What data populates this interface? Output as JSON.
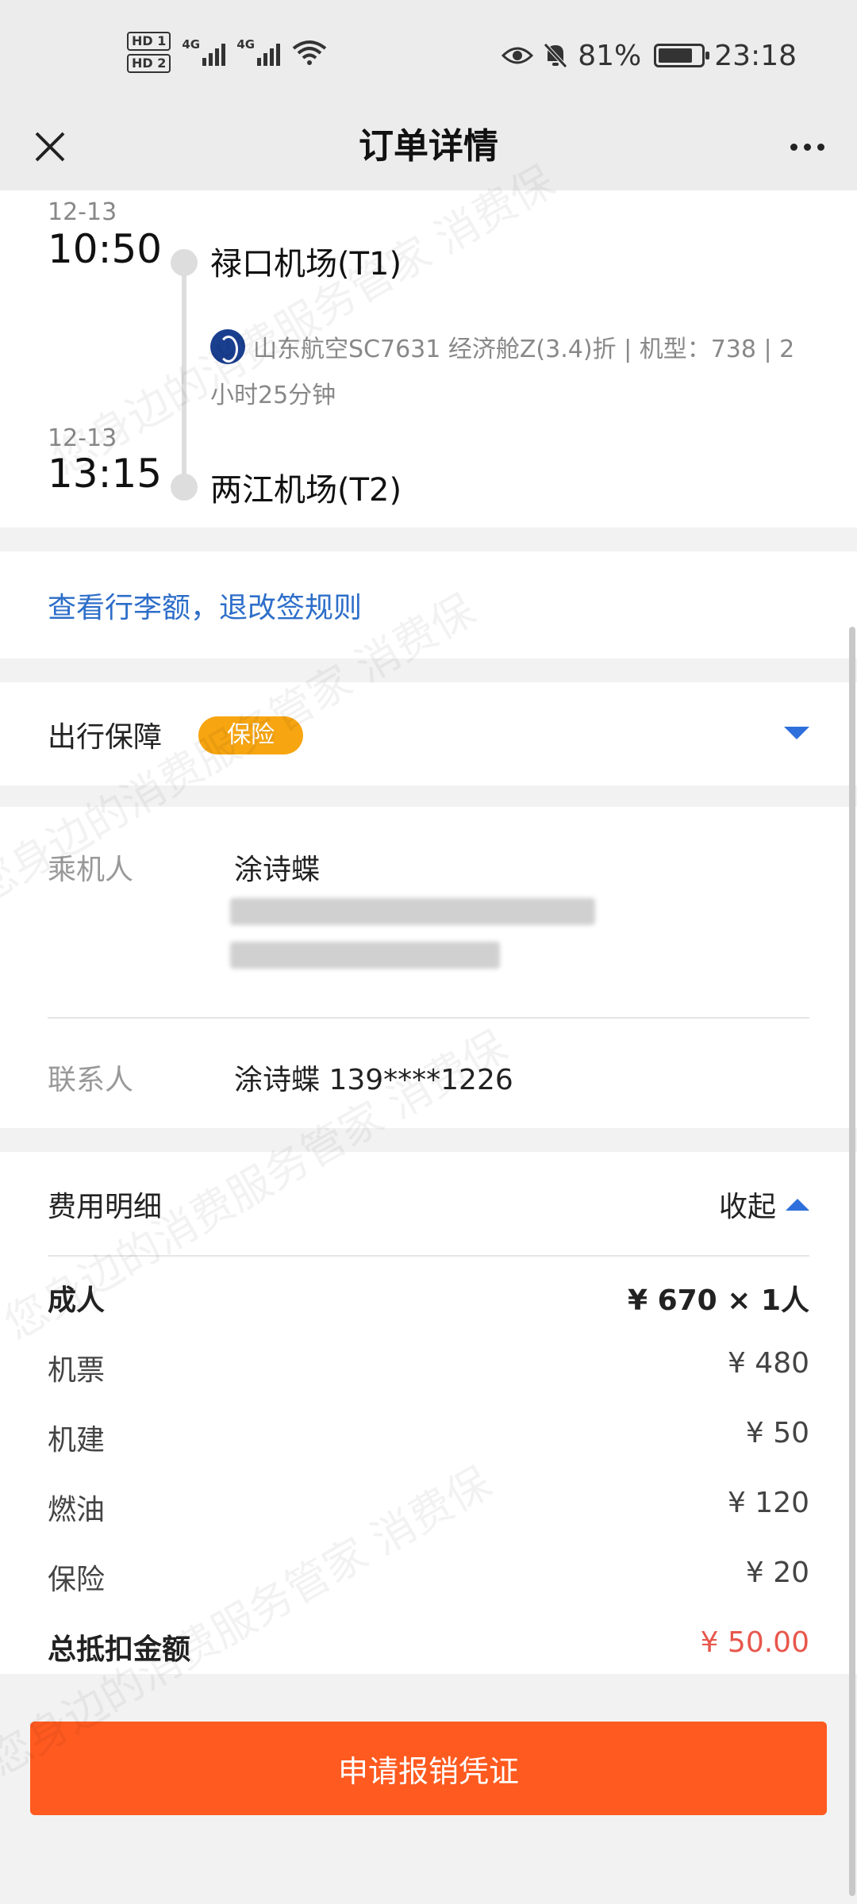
{
  "status_bar": {
    "hd1": "HD 1",
    "hd2": "HD 2",
    "net1": "4G",
    "net2": "4G",
    "battery": "81%",
    "time": "23:18"
  },
  "nav": {
    "title": "订单详情"
  },
  "flight": {
    "depart": {
      "date": "12-13",
      "time": "10:50",
      "airport": "禄口机场(T1)"
    },
    "info": "山东航空SC7631 经济舱Z(3.4)折 | 机型：738 | 2小时25分钟",
    "arrive": {
      "date": "12-13",
      "time": "13:15",
      "airport": "两江机场(T2)"
    }
  },
  "rules_link": "查看行李额，退改签规则",
  "insurance": {
    "label": "出行保障",
    "badge": "保险"
  },
  "passenger": {
    "label": "乘机人",
    "name": "涂诗蝶"
  },
  "contact": {
    "label": "联系人",
    "value": "涂诗蝶 139****1226"
  },
  "fees": {
    "title": "费用明细",
    "toggle": "收起",
    "adult_label": "成人",
    "adult_value": "¥ 670 × 1人",
    "items": [
      {
        "label": "机票",
        "value": "¥ 480"
      },
      {
        "label": "机建",
        "value": "¥ 50"
      },
      {
        "label": "燃油",
        "value": "¥ 120"
      },
      {
        "label": "保险",
        "value": "¥ 20"
      }
    ],
    "total_label": "总抵扣金额",
    "total_value": "¥ 50.00",
    "total_color": "#e8574c"
  },
  "apply_button": "申请报销凭证",
  "watermark": "您身边的消费服务管家 消费保",
  "colors": {
    "accent_blue": "#2e6fdb",
    "link_blue": "#2d6ec9",
    "badge_orange": "#f7a511",
    "button_orange": "#ff5a1f"
  }
}
